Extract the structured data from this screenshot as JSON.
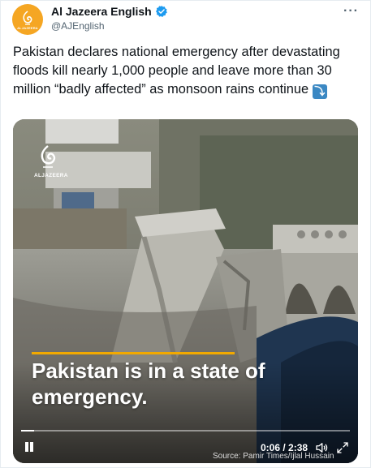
{
  "account": {
    "display_name": "Al Jazeera English",
    "handle": "@AJEnglish",
    "avatar_label": "ALJAZEERA",
    "verified": true,
    "brand_color": "#f5a623",
    "verified_color": "#1d9bf0"
  },
  "menu": {
    "more_label": "···"
  },
  "tweet": {
    "text": "Pakistan declares national emergency after devastating floods kill nearly 1,000 people and leave more than 30 million “badly affected” as monsoon rains continue",
    "emoji_icon": "down-arrow-emoji-icon",
    "emoji_glyph": "⤵"
  },
  "video": {
    "logo_label": "ALJAZEERA",
    "caption": "Pakistan is in a state of emergency.",
    "caption_accent": "#f2a900",
    "current_time": "0:06",
    "duration": "2:38",
    "time_display": "0:06 / 2:38",
    "progress": 0.04,
    "source": "Source: Pamir Times/Ijlal Hussain"
  }
}
